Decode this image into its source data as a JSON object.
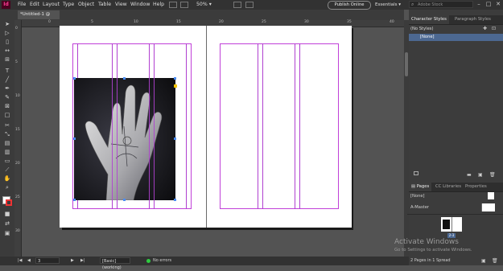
{
  "app": {
    "logo": "Id"
  },
  "menu": [
    "File",
    "Edit",
    "Layout",
    "Type",
    "Object",
    "Table",
    "View",
    "Window",
    "Help"
  ],
  "zoom": "50%",
  "publish_label": "Publish Online",
  "workspace": "Essentials",
  "stock_search_placeholder": "Adobe Stock",
  "window_controls": {
    "minimize": "–",
    "maximize": "□",
    "close": "✕"
  },
  "document": {
    "tab_title": "*Untitled-1 @ 50%",
    "tab_close": "×"
  },
  "ruler": {
    "h_ticks": [
      "0",
      "5",
      "10",
      "15",
      "20",
      "25",
      "30",
      "35",
      "40"
    ],
    "v_ticks": [
      "0",
      "5",
      "10",
      "15",
      "20",
      "25",
      "30"
    ]
  },
  "tools": [
    "select-tool",
    "direct-select-tool",
    "page-tool",
    "gap-tool",
    "content-collector-tool",
    "type-tool",
    "line-tool",
    "pen-tool",
    "pencil-tool",
    "rectangle-frame-tool",
    "rectangle-tool",
    "scissors-tool",
    "free-transform-tool",
    "gradient-tool",
    "gradient-feather-tool",
    "note-tool",
    "eyedropper-tool",
    "hand-tool",
    "zoom-tool",
    "fill-stroke-swatch",
    "swap-icon",
    "apply-color-icon",
    "view-mode-icon"
  ],
  "status": {
    "first_page_icon": "|◀",
    "prev_page_icon": "◀",
    "page_number": "3",
    "next_page_icon": "▶",
    "last_page_icon": "▶|",
    "preflight_profile": "[Basic] (working)",
    "errors": "No errors"
  },
  "panels": {
    "styles_tabs": [
      "Character Styles",
      "Paragraph Styles"
    ],
    "styles_list": [
      "(No Styles)",
      "[None]"
    ],
    "pages_tabs": [
      "Pages",
      "CC Libraries",
      "Properties"
    ],
    "pages_list": [
      "[None]",
      "A-Master"
    ],
    "spread_number": "2-3",
    "pages_footer": "2 Pages in 1 Spread"
  },
  "watermark": {
    "line1": "Activate Windows",
    "line2": "Go to Settings to activate Windows."
  },
  "colors": {
    "guide": "#c040d8",
    "selection": "#4a8cf5",
    "accent_row": "#4c6891",
    "no_errors": "#2ecc40"
  }
}
